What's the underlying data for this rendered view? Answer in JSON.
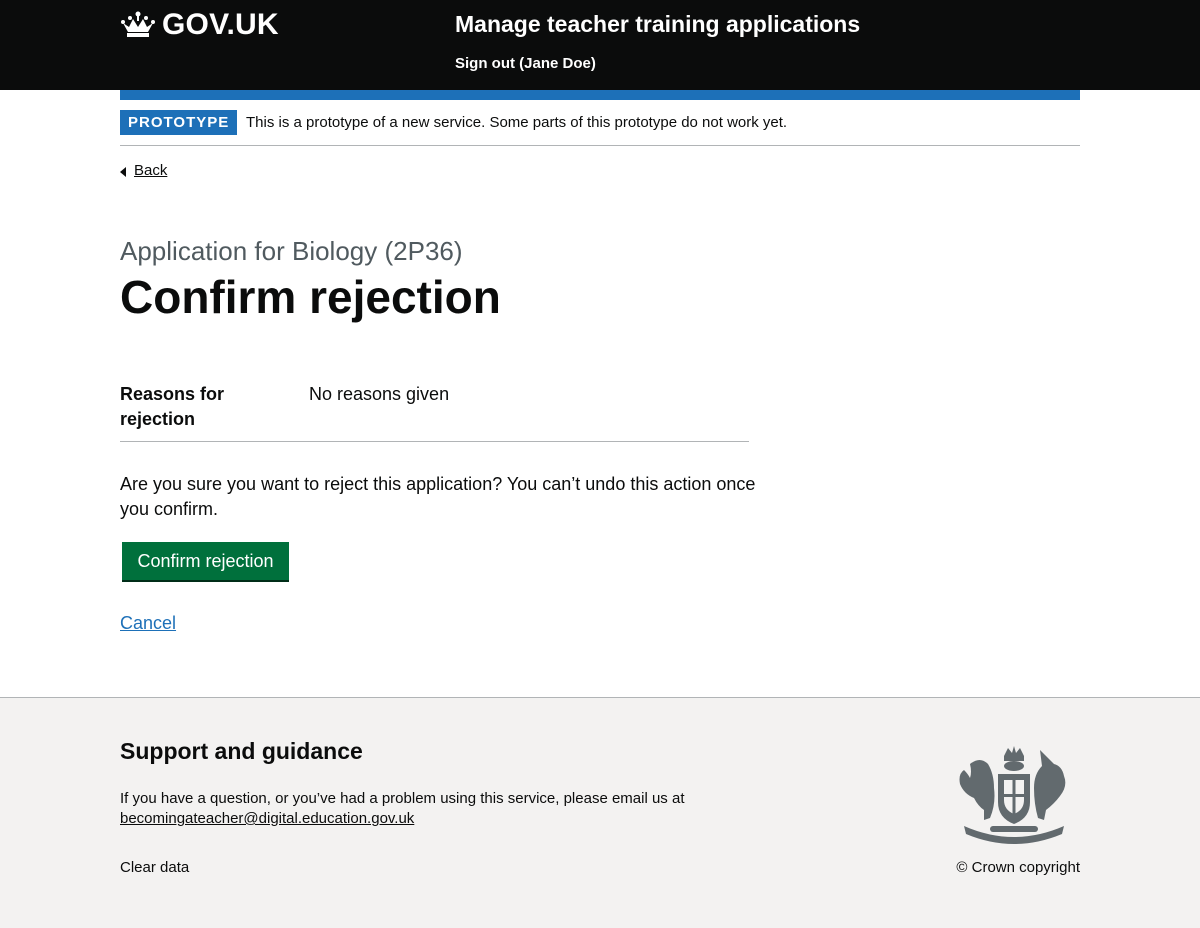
{
  "header": {
    "logo_text": "GOV.UK",
    "service_name": "Manage teacher training applications",
    "signout": "Sign out (Jane Doe)"
  },
  "phase_banner": {
    "tag": "PROTOTYPE",
    "text": "This is a prototype of a new service. Some parts of this prototype do not work yet."
  },
  "back_link": "Back",
  "caption": "Application for Biology (2P36)",
  "title": "Confirm rejection",
  "summary": {
    "key": "Reasons for rejection",
    "value": "No reasons given"
  },
  "question": "Are you sure you want to reject this application? You can’t undo this action once you confirm.",
  "confirm_button": "Confirm rejection",
  "cancel_link": "Cancel",
  "footer": {
    "heading": "Support and guidance",
    "text": "If you have a question, or you’ve had a problem using this service, please email us at",
    "email": "becomingateacher@digital.education.gov.uk",
    "clear_data": "Clear data",
    "copyright": "© Crown copyright"
  },
  "colors": {
    "header_bg": "#0b0c0c",
    "brand_blue": "#1d70b8",
    "button_green": "#00703c",
    "footer_bg": "#f3f2f1"
  },
  "icons": [
    "crown-icon",
    "back-chevron-icon",
    "royal-crest-icon"
  ]
}
